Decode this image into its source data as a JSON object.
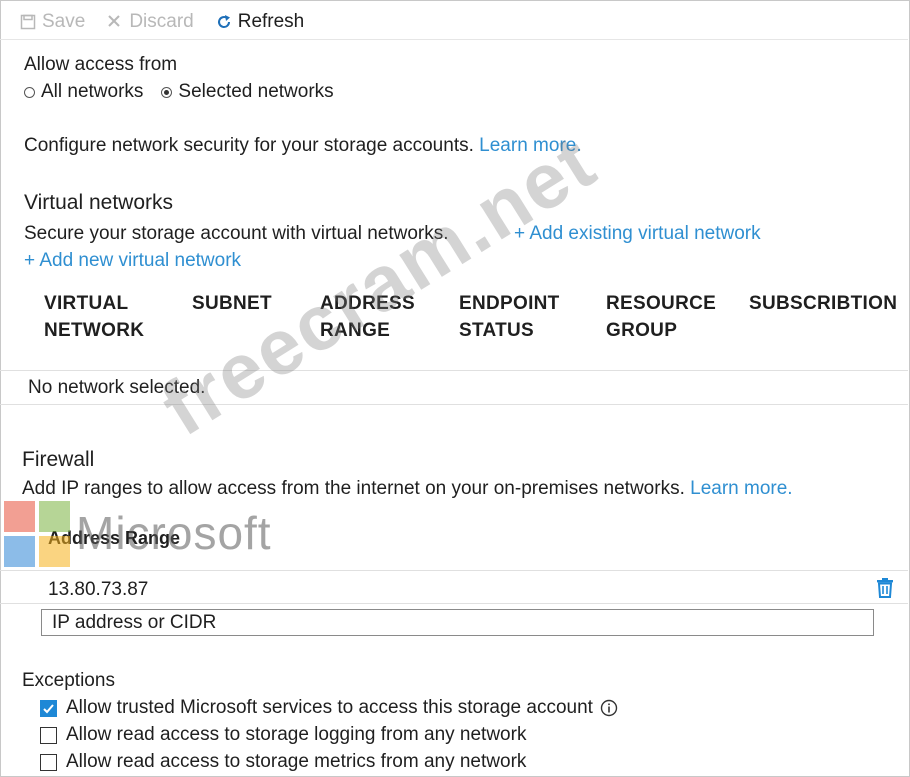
{
  "toolbar": {
    "save_label": "Save",
    "discard_label": "Discard",
    "refresh_label": "Refresh"
  },
  "access": {
    "heading": "Allow access from",
    "options": [
      "All networks",
      "Selected networks"
    ],
    "selected": "Selected networks"
  },
  "intro": {
    "text": "Configure network security for your storage accounts.",
    "learn_more": "Learn more."
  },
  "virtual_networks": {
    "title": "Virtual networks",
    "description": "Secure your storage account with virtual networks.",
    "add_existing": "+ Add existing virtual network",
    "add_new": "+ Add new virtual network",
    "columns": [
      [
        "VIRTUAL",
        "NETWORK"
      ],
      [
        "SUBNET",
        ""
      ],
      [
        "ADDRESS",
        "RANGE"
      ],
      [
        "ENDPOINT",
        "STATUS"
      ],
      [
        "RESOURCE",
        "GROUP"
      ],
      [
        "SUBSCRIBTION",
        ""
      ]
    ],
    "empty_message": "No network selected."
  },
  "firewall": {
    "title": "Firewall",
    "description": "Add IP ranges to allow access from the internet on your on-premises networks.",
    "learn_more": "Learn more.",
    "column": "Address Range",
    "rows": [
      "13.80.73.87"
    ],
    "input_placeholder": "IP address or CIDR"
  },
  "exceptions": {
    "title": "Exceptions",
    "items": [
      {
        "label": "Allow trusted Microsoft services to access this storage account",
        "checked": true
      },
      {
        "label": "Allow read access to storage logging from any network",
        "checked": false
      },
      {
        "label": "Allow read access to storage metrics from any network",
        "checked": false
      }
    ]
  },
  "watermark": {
    "brand": "Microsoft",
    "site": "freecram.net"
  },
  "colors": {
    "link": "#2f8fd1",
    "checkbox_checked": "#1e88d6",
    "trash_icon": "#1e88d6"
  }
}
